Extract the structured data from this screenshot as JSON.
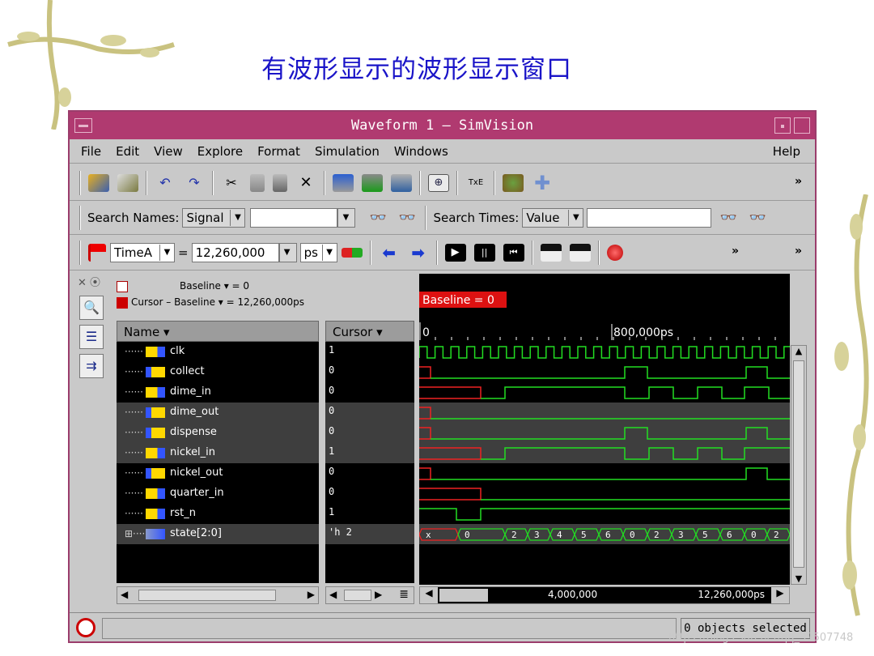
{
  "slide": {
    "title": "有波形显示的波形显示窗口",
    "watermark": "https://blog.csdn.net/qq_39507748"
  },
  "window": {
    "title": "Waveform 1 – SimVision",
    "accent": "#b03a70"
  },
  "menu": {
    "items": [
      "File",
      "Edit",
      "View",
      "Explore",
      "Format",
      "Simulation",
      "Windows"
    ],
    "help": "Help"
  },
  "search": {
    "names_label": "Search Names:",
    "names_mode": "Signal",
    "names_value": "",
    "times_label": "Search Times:",
    "times_mode": "Value",
    "times_value": ""
  },
  "timebar": {
    "marker": "TimeA",
    "equals": "=",
    "time_value": "12,260,000",
    "unit": "ps"
  },
  "info": {
    "baseline": "Baseline ▾ = 0",
    "cursor_baseline": "Cursor – Baseline ▾ = 12,260,000ps"
  },
  "columns": {
    "name": "Name ▾",
    "cursor": "Cursor ▾"
  },
  "waveform_header": {
    "baseline_tag": "Baseline = 0",
    "tick_start": "0",
    "tick_mid": "800,000ps",
    "scroll_mid": "4,000,000",
    "scroll_end": "12,260,000ps"
  },
  "signals": [
    {
      "name": "clk",
      "value": "1",
      "dir": "in"
    },
    {
      "name": "collect",
      "value": "0",
      "dir": "out"
    },
    {
      "name": "dime_in",
      "value": "0",
      "dir": "in"
    },
    {
      "name": "dime_out",
      "value": "0",
      "dir": "out"
    },
    {
      "name": "dispense",
      "value": "0",
      "dir": "out"
    },
    {
      "name": "nickel_in",
      "value": "1",
      "dir": "in"
    },
    {
      "name": "nickel_out",
      "value": "0",
      "dir": "out"
    },
    {
      "name": "quarter_in",
      "value": "0",
      "dir": "in"
    },
    {
      "name": "rst_n",
      "value": "1",
      "dir": "in"
    },
    {
      "name": "state[2:0]",
      "value": "'h 2",
      "dir": "bus"
    }
  ],
  "bus_values": [
    "x",
    "0",
    "2",
    "3",
    "4",
    "5",
    "6",
    "0",
    "2",
    "3",
    "5",
    "6",
    "0",
    "2"
  ],
  "status": {
    "selection": "0 objects selected"
  },
  "colors": {
    "wave_green": "#22dd22",
    "wave_red": "#ee2222",
    "bg_black": "#000000",
    "title_blue": "#1a14c8"
  }
}
